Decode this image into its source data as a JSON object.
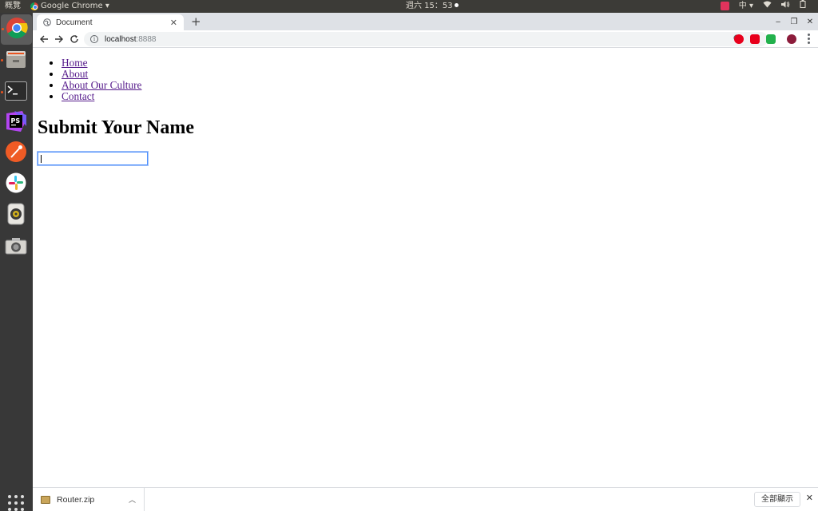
{
  "topbar": {
    "activities": "概覽",
    "app_name": "Google Chrome ▾",
    "clock": "週六 15：53",
    "input_method": "中 ▾",
    "wifi": "wifi-icon",
    "volume": "volume-icon",
    "power": "power-icon"
  },
  "dock": {
    "items": [
      "chrome-icon",
      "files-icon",
      "terminal-icon",
      "phpstorm-icon",
      "postman-icon",
      "slack-icon",
      "rhythmbox-icon",
      "screenshot-icon"
    ],
    "apps_grid": "show-applications-icon"
  },
  "browser": {
    "tab_title": "Document",
    "tab_close": "✕",
    "new_tab": "+",
    "url_host": "localhost",
    "url_port": ":8888",
    "window_controls": {
      "minimize": "‒",
      "restore": "❐",
      "close": "✕"
    }
  },
  "page": {
    "nav": [
      {
        "label": "Home"
      },
      {
        "label": "About"
      },
      {
        "label": "About Our Culture"
      },
      {
        "label": "Contact"
      }
    ],
    "heading": "Submit Your Name",
    "input_value": ""
  },
  "downloads": {
    "file_name": "Router.zip",
    "show_all": "全部顯示",
    "close": "✕"
  },
  "colors": {
    "link_visited": "#551a8b",
    "focus_ring": "#4d90fe",
    "topbar_bg": "#3c3b37",
    "dock_bg": "#383838",
    "tabstrip_bg": "#dee1e6",
    "bookmark_star": "#4285f4"
  }
}
